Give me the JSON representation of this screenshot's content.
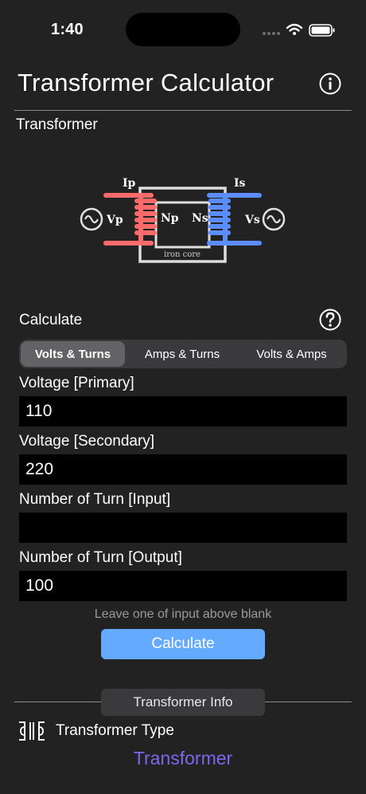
{
  "status": {
    "time": "1:40"
  },
  "header": {
    "title": "Transformer Calculator"
  },
  "diagram_section": {
    "label": "Transformer"
  },
  "diagram": {
    "ip": "Ip",
    "is": "Is",
    "vp": "Vp",
    "vs": "Vs",
    "np": "Np",
    "ns": "Ns",
    "core": "iron core",
    "primary_color": "#ff6b6b",
    "secondary_color": "#5b8dff"
  },
  "calculate_section": {
    "label": "Calculate"
  },
  "tabs": [
    {
      "label": "Volts & Turns",
      "active": true
    },
    {
      "label": "Amps & Turns",
      "active": false
    },
    {
      "label": "Volts & Amps",
      "active": false
    }
  ],
  "fields": [
    {
      "label": "Voltage [Primary]",
      "value": "110"
    },
    {
      "label": "Voltage [Secondary]",
      "value": "220"
    },
    {
      "label": "Number of Turn [Input]",
      "value": ""
    },
    {
      "label": "Number of Turn [Output]",
      "value": "100"
    }
  ],
  "hint": "Leave one of input above blank",
  "calculate_button": "Calculate",
  "info_tab": "Transformer Info",
  "type": {
    "label": "Transformer Type",
    "value": "Transformer"
  },
  "colors": {
    "accent": "#64aaff",
    "type_value": "#7b68ee",
    "background": "#222222"
  }
}
